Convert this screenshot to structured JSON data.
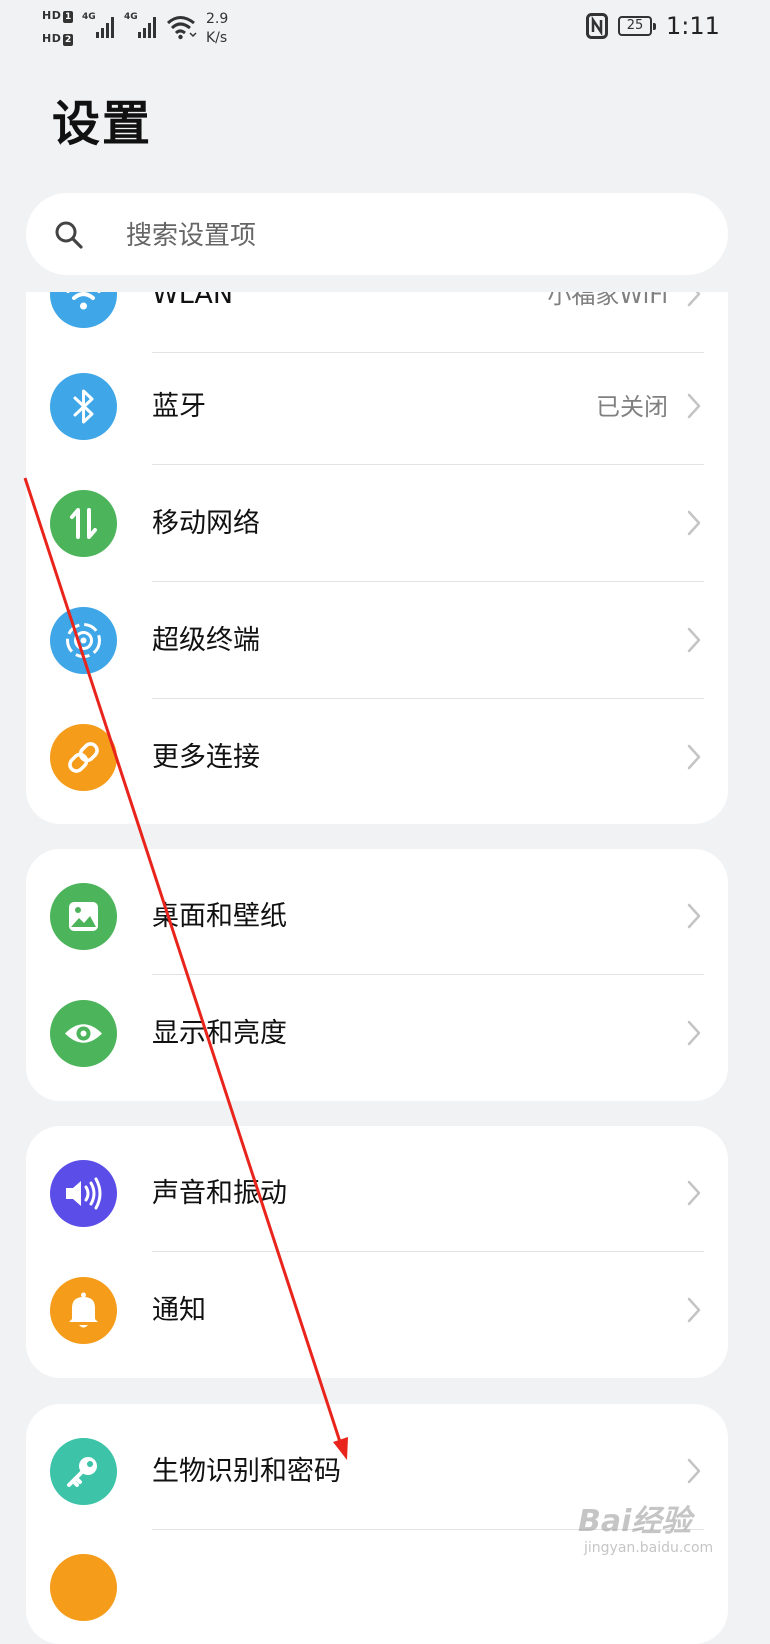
{
  "status_bar": {
    "hd1": "HD",
    "hd1_num": "1",
    "hd2": "HD",
    "hd2_num": "2",
    "network_1": "4G",
    "network_2": "4G",
    "speed_value": "2.9",
    "speed_unit": "K/s",
    "battery": "25",
    "time": "1:11"
  },
  "page": {
    "title": "设置"
  },
  "search": {
    "placeholder": "搜索设置项"
  },
  "groups": [
    {
      "items": [
        {
          "label": "WLAN",
          "value": "小福家WiFi",
          "icon": "wifi-icon",
          "color": "#3fa6e8"
        },
        {
          "label": "蓝牙",
          "value": "已关闭",
          "icon": "bluetooth-icon",
          "color": "#3fa6e8"
        },
        {
          "label": "移动网络",
          "value": "",
          "icon": "mobile-data-icon",
          "color": "#4cb45a"
        },
        {
          "label": "超级终端",
          "value": "",
          "icon": "super-device-icon",
          "color": "#3fa6e8"
        },
        {
          "label": "更多连接",
          "value": "",
          "icon": "link-icon",
          "color": "#f59c1a"
        }
      ]
    },
    {
      "items": [
        {
          "label": "桌面和壁纸",
          "value": "",
          "icon": "wallpaper-icon",
          "color": "#4cb45a"
        },
        {
          "label": "显示和亮度",
          "value": "",
          "icon": "eye-icon",
          "color": "#4cb45a"
        }
      ]
    },
    {
      "items": [
        {
          "label": "声音和振动",
          "value": "",
          "icon": "speaker-icon",
          "color": "#5b4ee8"
        },
        {
          "label": "通知",
          "value": "",
          "icon": "bell-icon",
          "color": "#f59c1a"
        }
      ]
    },
    {
      "items": [
        {
          "label": "生物识别和密码",
          "value": "",
          "icon": "key-icon",
          "color": "#3cc3a8"
        }
      ]
    }
  ],
  "watermark": {
    "main": "Bai经验",
    "sub": "jingyan.baidu.com"
  }
}
